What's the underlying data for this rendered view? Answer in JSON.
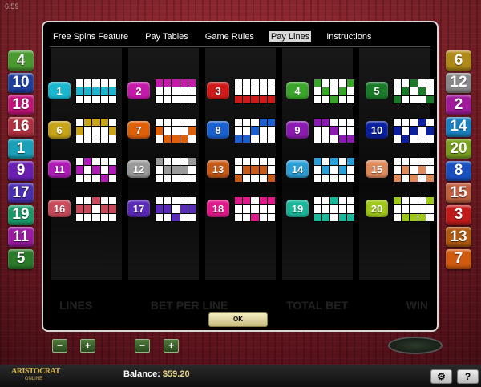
{
  "corner_text": "6.59",
  "tabs": [
    {
      "label": "Free Spins Feature",
      "active": false
    },
    {
      "label": "Pay Tables",
      "active": false
    },
    {
      "label": "Game Rules",
      "active": false
    },
    {
      "label": "Pay Lines",
      "active": true
    },
    {
      "label": "Instructions",
      "active": false
    }
  ],
  "left_badges": [
    {
      "n": "4",
      "color": "#4a9a30"
    },
    {
      "n": "10",
      "color": "#1e3f9e"
    },
    {
      "n": "18",
      "color": "#c4127a"
    },
    {
      "n": "16",
      "color": "#b03040"
    },
    {
      "n": "1",
      "color": "#1aa0b8"
    },
    {
      "n": "9",
      "color": "#6a1fb0"
    },
    {
      "n": "17",
      "color": "#4a2fb0"
    },
    {
      "n": "19",
      "color": "#1a9a6a"
    },
    {
      "n": "11",
      "color": "#9a1aa0"
    },
    {
      "n": "5",
      "color": "#2a7a2a"
    }
  ],
  "right_badges": [
    {
      "n": "6",
      "color": "#b08a18"
    },
    {
      "n": "12",
      "color": "#8a8a8a"
    },
    {
      "n": "2",
      "color": "#a01a9a"
    },
    {
      "n": "14",
      "color": "#1a80c0"
    },
    {
      "n": "20",
      "color": "#7aa020"
    },
    {
      "n": "8",
      "color": "#1a50c0"
    },
    {
      "n": "15",
      "color": "#c06040"
    },
    {
      "n": "3",
      "color": "#c01a1a"
    },
    {
      "n": "13",
      "color": "#b05a10"
    },
    {
      "n": "7",
      "color": "#d05a10"
    }
  ],
  "paylines": [
    {
      "n": "1",
      "color": "#1ab8d0",
      "rows": [
        1,
        1,
        1,
        1,
        1
      ]
    },
    {
      "n": "2",
      "color": "#c41aaa",
      "rows": [
        0,
        0,
        0,
        0,
        0
      ]
    },
    {
      "n": "3",
      "color": "#d01a1a",
      "rows": [
        2,
        2,
        2,
        2,
        2
      ]
    },
    {
      "n": "4",
      "color": "#3aa52a",
      "rows": [
        0,
        1,
        2,
        1,
        0
      ]
    },
    {
      "n": "5",
      "color": "#1a7a2a",
      "rows": [
        2,
        1,
        0,
        1,
        2
      ]
    },
    {
      "n": "6",
      "color": "#c8a418",
      "rows": [
        1,
        0,
        0,
        0,
        1
      ]
    },
    {
      "n": "7",
      "color": "#e0600a",
      "rows": [
        1,
        2,
        2,
        2,
        1
      ]
    },
    {
      "n": "8",
      "color": "#1a60d0",
      "rows": [
        2,
        2,
        1,
        0,
        0
      ]
    },
    {
      "n": "9",
      "color": "#8a1ab0",
      "rows": [
        0,
        0,
        1,
        2,
        2
      ]
    },
    {
      "n": "10",
      "color": "#0a20a0",
      "rows": [
        1,
        2,
        1,
        0,
        1
      ]
    },
    {
      "n": "11",
      "color": "#b01ab8",
      "rows": [
        1,
        0,
        1,
        2,
        1
      ]
    },
    {
      "n": "12",
      "color": "#9a9a9a",
      "rows": [
        0,
        1,
        1,
        1,
        0
      ]
    },
    {
      "n": "13",
      "color": "#c85a18",
      "rows": [
        2,
        1,
        1,
        1,
        2
      ]
    },
    {
      "n": "14",
      "color": "#2aa0d8",
      "rows": [
        0,
        1,
        0,
        1,
        0
      ]
    },
    {
      "n": "15",
      "color": "#e08a5a",
      "rows": [
        2,
        1,
        2,
        1,
        2
      ]
    },
    {
      "n": "16",
      "color": "#c84a5a",
      "rows": [
        1,
        1,
        0,
        1,
        1
      ]
    },
    {
      "n": "17",
      "color": "#5a2ab8",
      "rows": [
        1,
        1,
        2,
        1,
        1
      ]
    },
    {
      "n": "18",
      "color": "#e01a8a",
      "rows": [
        0,
        0,
        2,
        0,
        0
      ]
    },
    {
      "n": "19",
      "color": "#1ab89a",
      "rows": [
        2,
        2,
        0,
        2,
        2
      ]
    },
    {
      "n": "20",
      "color": "#a0c81a",
      "rows": [
        0,
        2,
        2,
        2,
        0
      ]
    }
  ],
  "reel_footer": [
    "LINES",
    "BET PER LINE",
    "TOTAL BET",
    "WIN"
  ],
  "ok_label": "OK",
  "controls": {
    "minus": "−",
    "plus": "+"
  },
  "logo": {
    "top": "ARISTOCRAT",
    "bottom": "ONLINE"
  },
  "balance": {
    "label": "Balance:",
    "value": "$59.20"
  },
  "settings_icon": "gear-icon",
  "help_label": "?"
}
